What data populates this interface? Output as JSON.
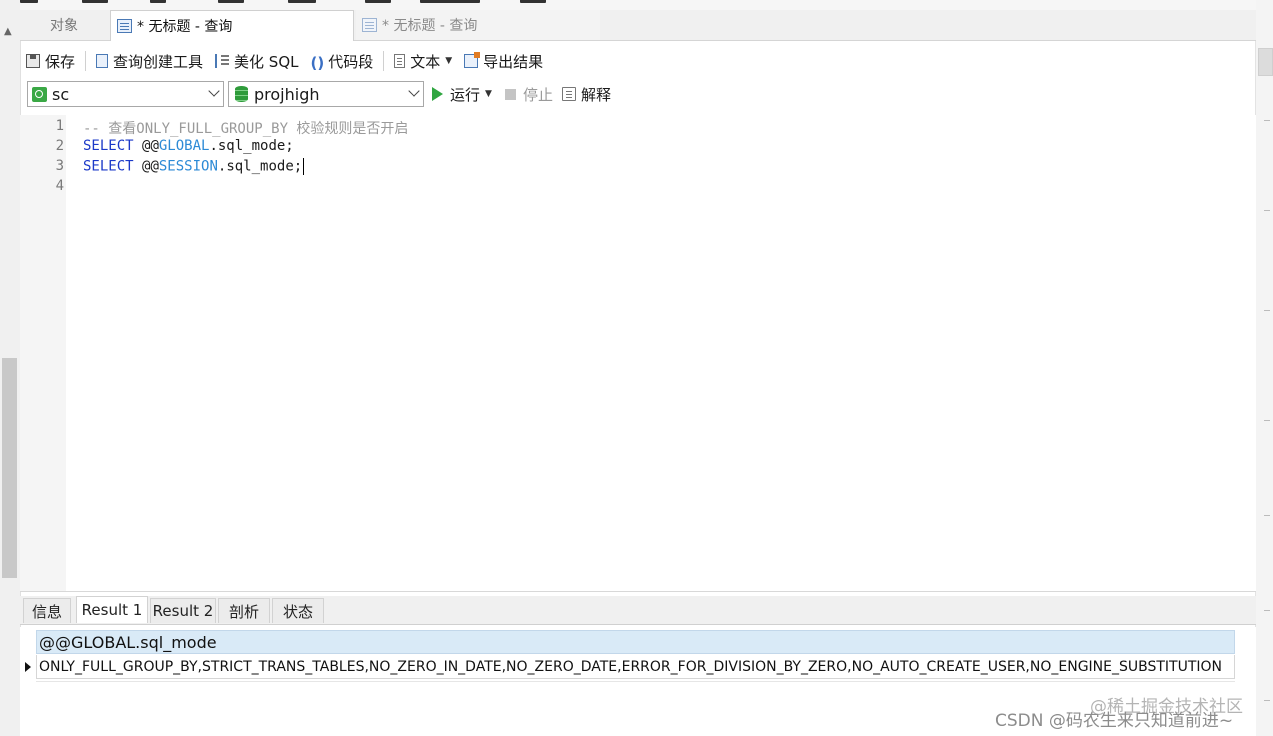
{
  "tabs": {
    "objects": "对象",
    "active_query": "* 无标题 - 查询",
    "inactive_query": "* 无标题 - 查询"
  },
  "toolbar": {
    "save": "保存",
    "query_builder": "查询创建工具",
    "beautify_sql": "美化 SQL",
    "code_snippet": "代码段",
    "text": "文本",
    "export_results": "导出结果"
  },
  "connection": {
    "connection_value": "sc",
    "database_value": "projhigh",
    "run": "运行",
    "stop": "停止",
    "explain": "解释"
  },
  "editor": {
    "line_numbers": [
      "1",
      "2",
      "3",
      "4"
    ],
    "line1": "-- 查看ONLY_FULL_GROUP_BY 校验规则是否开启",
    "line2_kw": "SELECT",
    "line2_at": "@@",
    "line2_sys": "GLOBAL",
    "line2_rest": ".sql_mode;",
    "line3_kw": "SELECT",
    "line3_at": "@@",
    "line3_sys": "SESSION",
    "line3_rest": ".sql_mode;"
  },
  "result_tabs": [
    "信息",
    "Result 1",
    "Result 2",
    "剖析",
    "状态"
  ],
  "result": {
    "column_header": "@@GLOBAL.sql_mode",
    "row_value": "ONLY_FULL_GROUP_BY,STRICT_TRANS_TABLES,NO_ZERO_IN_DATE,NO_ZERO_DATE,ERROR_FOR_DIVISION_BY_ZERO,NO_AUTO_CREATE_USER,NO_ENGINE_SUBSTITUTION"
  },
  "watermarks": {
    "line1": "@稀土掘金技术社区",
    "line2": "CSDN @码农生来只知道前进~"
  }
}
